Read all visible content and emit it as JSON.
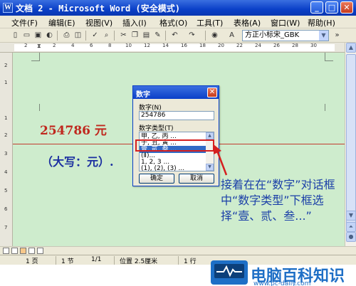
{
  "window": {
    "title": "文档 2 - Microsoft Word (安全模式)",
    "minimize_glyph": "_",
    "maximize_glyph": "□",
    "close_glyph": "✕"
  },
  "menu": [
    {
      "label": "文件(F)"
    },
    {
      "label": "编辑(E)"
    },
    {
      "label": "视图(V)"
    },
    {
      "label": "插入(I)"
    },
    {
      "label": "格式(O)"
    },
    {
      "label": "工具(T)"
    },
    {
      "label": "表格(A)"
    },
    {
      "label": "窗口(W)"
    },
    {
      "label": "帮助(H)"
    }
  ],
  "toolbar": {
    "icons": [
      "new-icon",
      "open-icon",
      "save-icon",
      "permission-icon",
      "print-icon",
      "print-preview-icon",
      "spelling-icon",
      "research-icon",
      "cut-icon",
      "copy-icon",
      "paste-icon",
      "format-painter-icon",
      "undo-icon",
      "redo-icon",
      "hyperlink-icon"
    ],
    "font_name": "方正小标宋_GBK"
  },
  "ruler": {
    "numbers": [
      "2",
      "2",
      "4",
      "6",
      "8",
      "10",
      "12",
      "14",
      "16",
      "18",
      "20",
      "22",
      "24",
      "26",
      "28",
      "30"
    ]
  },
  "vruler": {
    "numbers": [
      "2",
      "1",
      "1",
      "2",
      "3",
      "4",
      "5",
      "6",
      "7"
    ]
  },
  "document": {
    "number_line": "254786 元",
    "daxie_line": "（大写：元）.",
    "annotation": "接着在在“数字”对话框中“数字类型”下框选择“壹、贰、叁...”"
  },
  "dialog": {
    "title": "数字",
    "number_label": "数字(N)",
    "number_value": "254786",
    "type_label": "数字类型(T)",
    "type_options": [
      "甲, 乙, 丙 ...",
      "子, 丑, 寅 ...",
      "壹, 贰, 叁 ...",
      "(Ⅱ)...",
      "1, 2, 3 ...",
      "(1), (2), (3) ..."
    ],
    "selected_index": 2,
    "ok_label": "确定",
    "cancel_label": "取消"
  },
  "statusbar": {
    "page": "1 页",
    "section": "1 节",
    "page_of": "1/1",
    "position": "位置 2.5厘米",
    "line": "1 行"
  },
  "logo": {
    "name": "电脑百科知识",
    "url": "www.pc-daily.com"
  },
  "colors": {
    "doc_background": "#ceeccd",
    "number_red": "#c0281e",
    "daxie_blue": "#1a2ea0",
    "annotation_blue": "#1b3fa8",
    "highlight_red": "#d51f1f"
  }
}
